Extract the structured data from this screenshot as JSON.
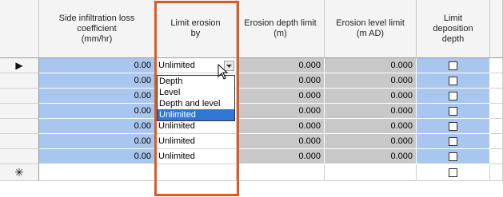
{
  "grid": {
    "columns": [
      {
        "key": "side_infiltration",
        "label": "Side infiltration loss\ncoefficient\n(mm/hr)"
      },
      {
        "key": "limit_erosion_by",
        "label": "Limit erosion\nby"
      },
      {
        "key": "erosion_depth_limit",
        "label": "Erosion depth limit\n(m)"
      },
      {
        "key": "erosion_level_limit",
        "label": "Erosion level limit\n(m AD)"
      },
      {
        "key": "limit_deposition_depth",
        "label": "Limit\ndeposition\ndepth"
      }
    ],
    "current_row_marker": "▶",
    "new_row_marker": "✳",
    "rows": [
      {
        "side_infiltration": "0.00",
        "limit_erosion_by": "Unlimited",
        "erosion_depth_limit": "0.000",
        "erosion_level_limit": "0.000",
        "limit_deposition_depth": false
      },
      {
        "side_infiltration": "0.00",
        "limit_erosion_by": "Unlimited",
        "erosion_depth_limit": "0.000",
        "erosion_level_limit": "0.000",
        "limit_deposition_depth": false
      },
      {
        "side_infiltration": "0.00",
        "limit_erosion_by": "Unlimited",
        "erosion_depth_limit": "0.000",
        "erosion_level_limit": "0.000",
        "limit_deposition_depth": false
      },
      {
        "side_infiltration": "0.00",
        "limit_erosion_by": "Unlimited",
        "erosion_depth_limit": "0.000",
        "erosion_level_limit": "0.000",
        "limit_deposition_depth": false
      },
      {
        "side_infiltration": "0.00",
        "limit_erosion_by": "Unlimited",
        "erosion_depth_limit": "0.000",
        "erosion_level_limit": "0.000",
        "limit_deposition_depth": false
      },
      {
        "side_infiltration": "0.00",
        "limit_erosion_by": "Unlimited",
        "erosion_depth_limit": "0.000",
        "erosion_level_limit": "0.000",
        "limit_deposition_depth": false
      },
      {
        "side_infiltration": "0.00",
        "limit_erosion_by": "Unlimited",
        "erosion_depth_limit": "0.000",
        "erosion_level_limit": "0.000",
        "limit_deposition_depth": false
      }
    ],
    "new_row": {
      "limit_deposition_depth": false
    }
  },
  "dropdown": {
    "options": [
      "Depth",
      "Level",
      "Depth and level",
      "Unlimited"
    ],
    "selected": "Unlimited"
  },
  "colors": {
    "highlight": "#e05a1e",
    "selected_option": "#3178d6",
    "editable_cell": "#a9c6ee",
    "readonly_cell": "#c8c8c8"
  },
  "icons": {
    "dropdown_arrow": "chevron-down-icon",
    "cursor": "mouse-pointer-icon"
  }
}
